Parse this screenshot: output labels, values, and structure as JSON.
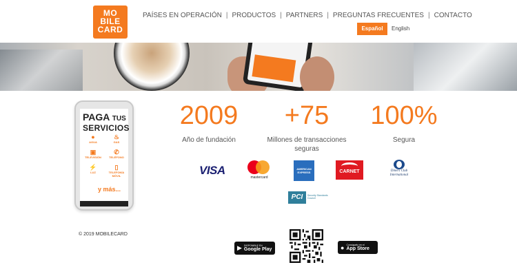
{
  "brand": {
    "logo_lines": [
      "MO",
      "BILE",
      "CARD"
    ]
  },
  "nav": {
    "items": [
      "PAÍSES EN OPERACIÓN",
      "PRODUCTOS",
      "PARTNERS",
      "PREGUNTAS FRECUENTES",
      "CONTACTO"
    ]
  },
  "language": {
    "active": "Español",
    "other": "English"
  },
  "promo": {
    "title_line1": "PAGA",
    "title_tus": "TUS",
    "title_line2": "SERVICIOS",
    "services": [
      "AGUA",
      "GAS",
      "TELEVISIÓN",
      "TELÉFONO",
      "LUZ",
      "TELEFONÍA MÓVIL"
    ],
    "more": "y más..."
  },
  "stats": [
    {
      "value": "2009",
      "label": "Año de fundación"
    },
    {
      "value": "+75",
      "label": "Millones de transacciones seguras"
    },
    {
      "value": "100%",
      "label": "Segura"
    }
  ],
  "cards": {
    "visa": "VISA",
    "mastercard": "mastercard",
    "amex": "AMERICAN EXPRESS",
    "carnet": "CARNET",
    "diners": "Diners Club International",
    "pci_mark": "PCI",
    "pci_text": "Security Standards Council"
  },
  "footer": {
    "copyright": "© 2019 MOBILECARD",
    "google_play_small": "DISPONIBLE EN",
    "google_play_big": "Google Play",
    "app_store_small": "Consíguelo en el",
    "app_store_big": "App Store"
  },
  "colors": {
    "accent": "#f47a1f"
  }
}
